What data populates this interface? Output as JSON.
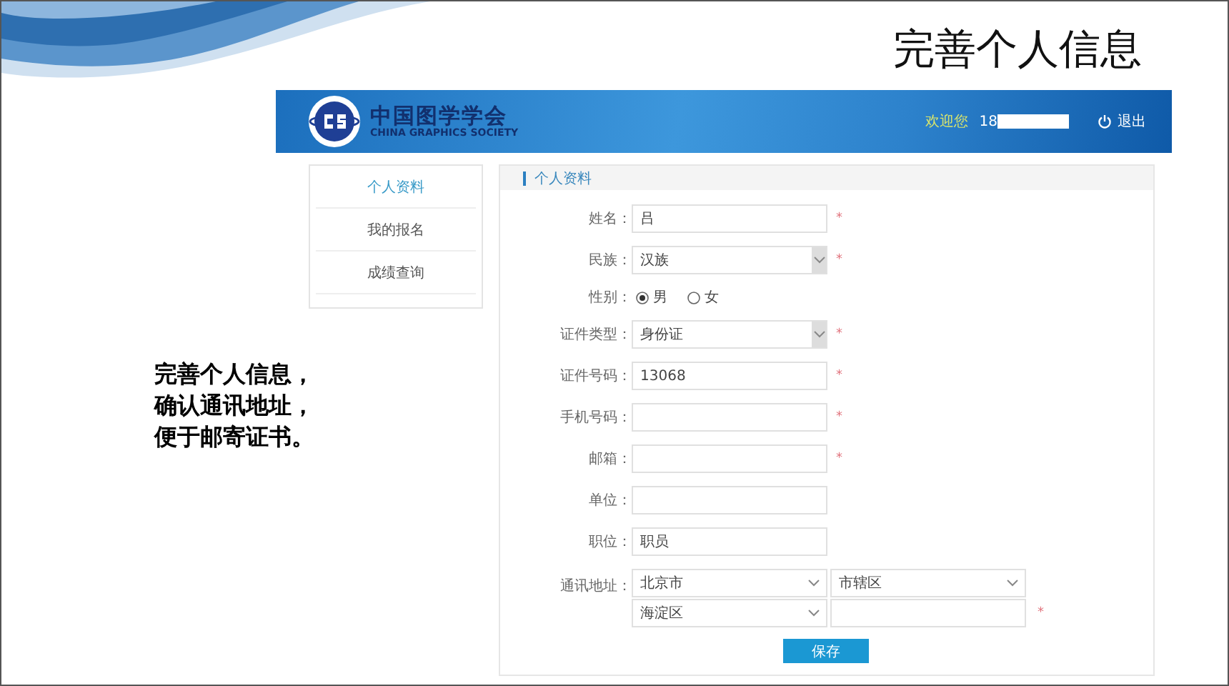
{
  "slide": {
    "title": "完善个人信息",
    "note_lines": [
      "完善个人信息，",
      "确认通讯地址，",
      "便于邮寄证书。"
    ]
  },
  "site": {
    "logo_cn": "中国图学学会",
    "logo_en": "CHINA GRAPHICS SOCIETY",
    "welcome": "欢迎您",
    "user": "18",
    "logout": "退出"
  },
  "sidebar": {
    "items": [
      {
        "label": "个人资料",
        "selected": true
      },
      {
        "label": "我的报名",
        "selected": false
      },
      {
        "label": "成绩查询",
        "selected": false
      }
    ]
  },
  "panel": {
    "title": "个人资料"
  },
  "form": [
    {
      "kind": "text",
      "label": "姓名：",
      "value": "吕",
      "required_mark": "*"
    },
    {
      "kind": "select",
      "label": "民族：",
      "value": "汉族",
      "required_mark": "*"
    },
    {
      "kind": "radio",
      "label": "性别：",
      "options": [
        {
          "label": "男",
          "selected": true
        },
        {
          "label": "女",
          "selected": false
        }
      ]
    },
    {
      "kind": "select",
      "label": "证件类型：",
      "value": "身份证",
      "required_mark": "*"
    },
    {
      "kind": "text",
      "label": "证件号码：",
      "value": "13068",
      "required_mark": "*"
    },
    {
      "kind": "text",
      "label": "手机号码：",
      "required_mark": "*"
    },
    {
      "kind": "text",
      "label": "邮箱：",
      "required_mark": "*"
    },
    {
      "kind": "text",
      "label": "单位："
    },
    {
      "kind": "text",
      "label": "职位：",
      "value": "职员"
    },
    {
      "kind": "address",
      "label": "通讯地址：",
      "province": "北京市",
      "city": "市辖区",
      "district": "海淀区",
      "required_mark": "*"
    }
  ],
  "save_button": "保存"
}
